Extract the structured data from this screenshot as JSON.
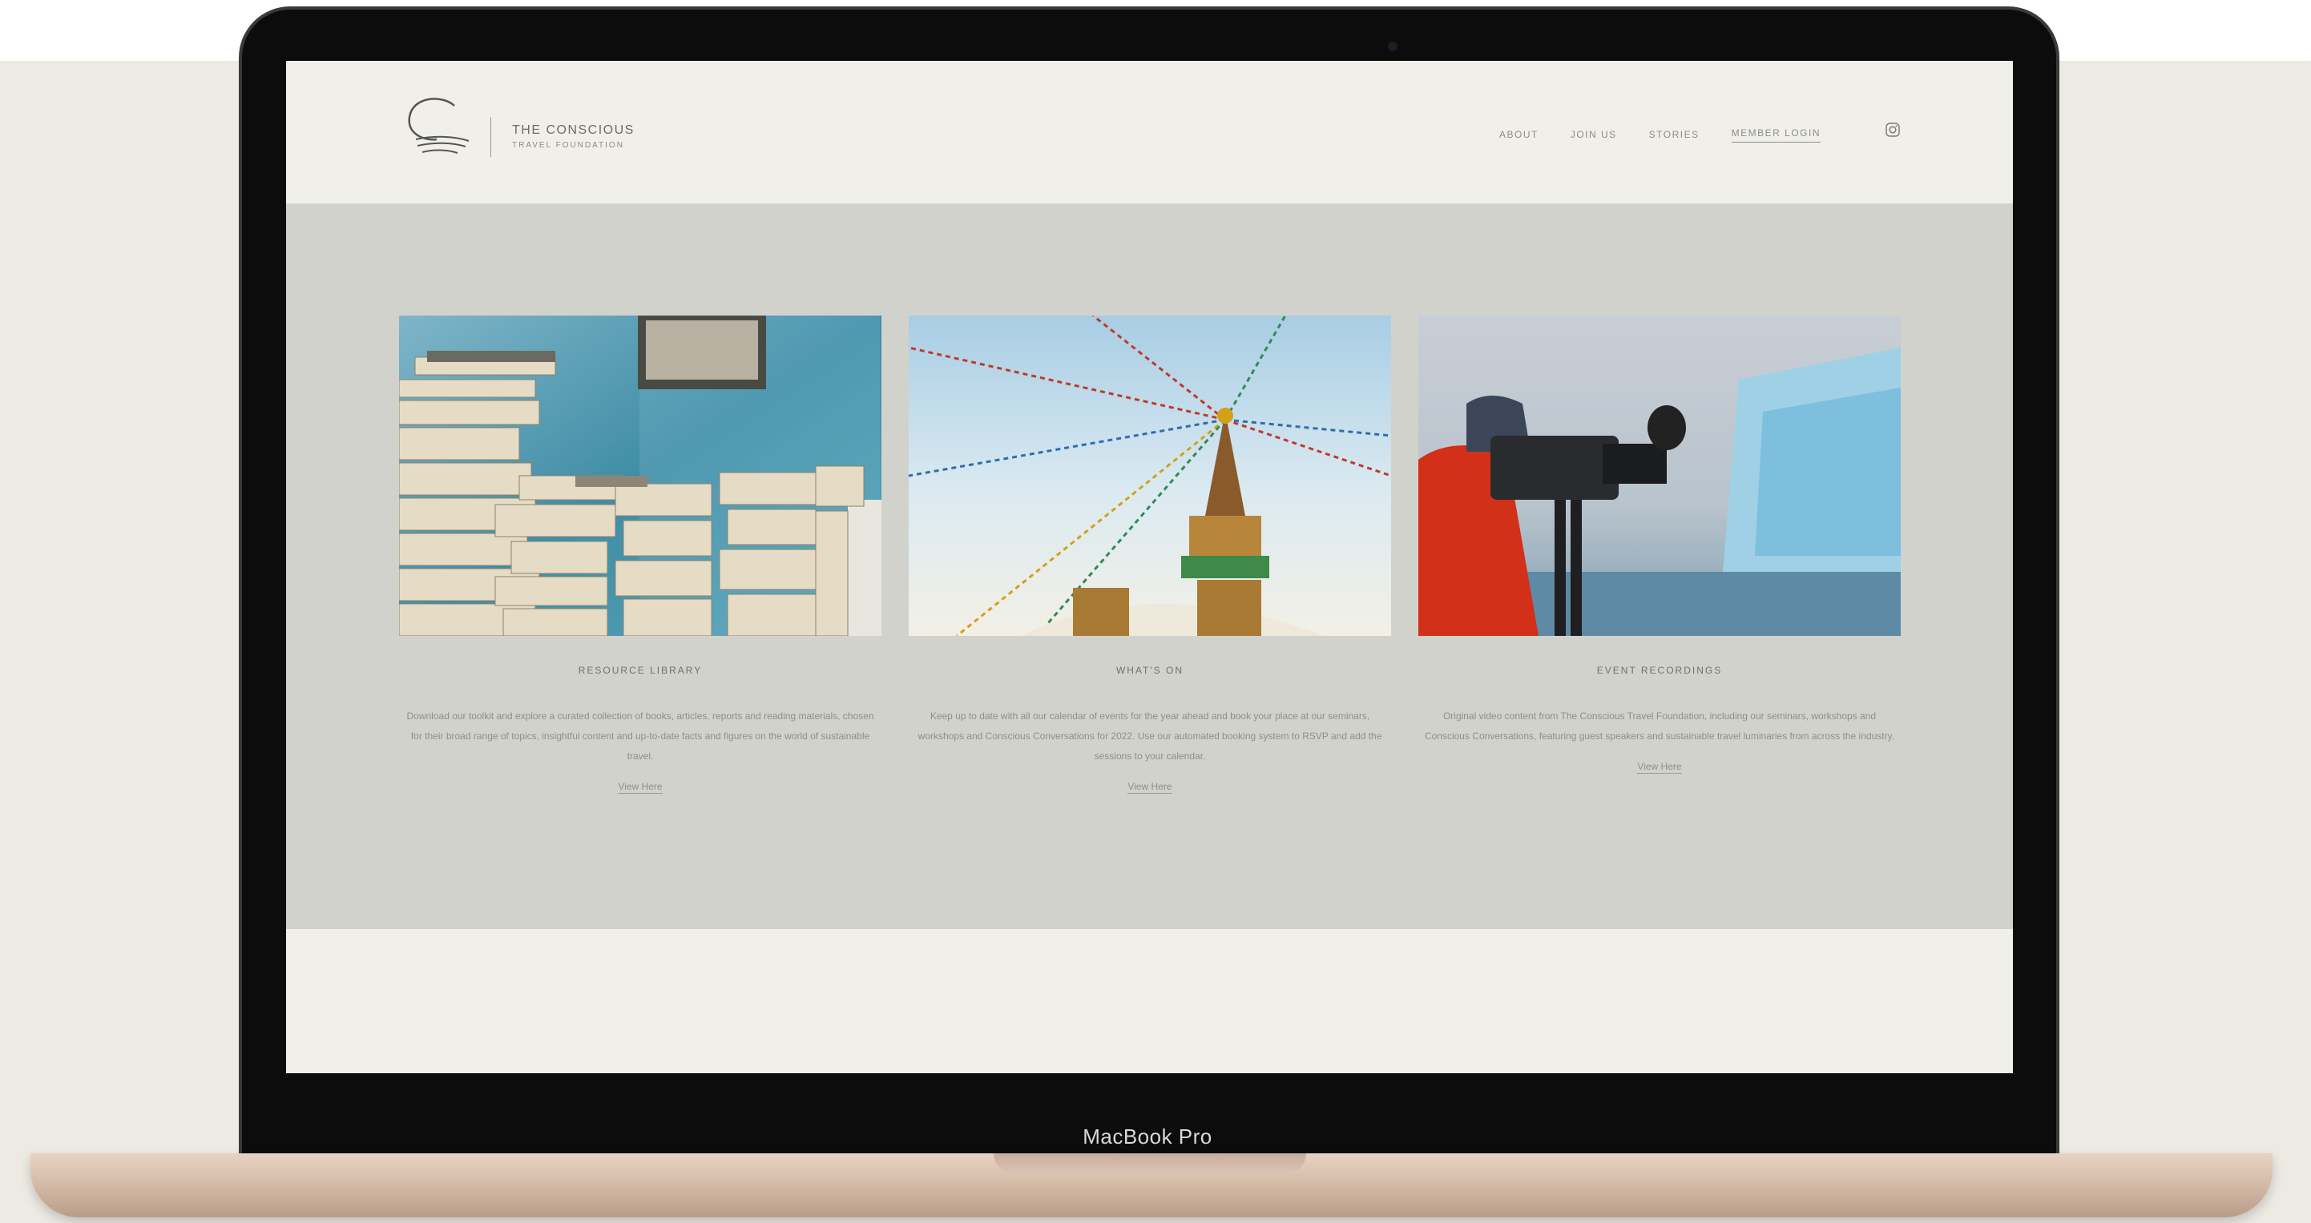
{
  "device": {
    "label": "MacBook Pro"
  },
  "site": {
    "logo": {
      "title": "THE CONSCIOUS",
      "subtitle": "TRAVEL FOUNDATION"
    },
    "nav": [
      {
        "label": "ABOUT"
      },
      {
        "label": "JOIN US"
      },
      {
        "label": "STORIES"
      },
      {
        "label": "MEMBER LOGIN",
        "active": true
      }
    ],
    "social_icon": "instagram-icon"
  },
  "cards": [
    {
      "title": "RESOURCE LIBRARY",
      "description": "Download our toolkit and explore a curated collection of books, articles, reports and reading materials, chosen for their broad range of topics, insightful content and up-to-date facts and figures on the world of sustainable travel.",
      "link": "View Here",
      "image": "stacks-of-books-photo"
    },
    {
      "title": "WHAT'S ON",
      "description": "Keep up to date with all our calendar of events for the year ahead and book your place at our seminars, workshops and Conscious Conversations for 2022. Use our automated booking system to RSVP and add the sessions to your calendar.",
      "link": "View Here",
      "image": "stupa-prayer-flags-photo"
    },
    {
      "title": "EVENT RECORDINGS",
      "description": "Original video content from The Conscious Travel Foundation, including our seminars, workshops and Conscious Conversations, featuring guest speakers and sustainable travel luminaries from across the industry.",
      "link": "View Here",
      "image": "camera-operator-iceberg-photo"
    }
  ],
  "colors": {
    "page_bg": "#edeae4",
    "screen_bg": "#f0efea",
    "band_bg": "#d2d2cd",
    "bezel": "#0c0c0d",
    "laptop_base": "#d5bda9"
  }
}
